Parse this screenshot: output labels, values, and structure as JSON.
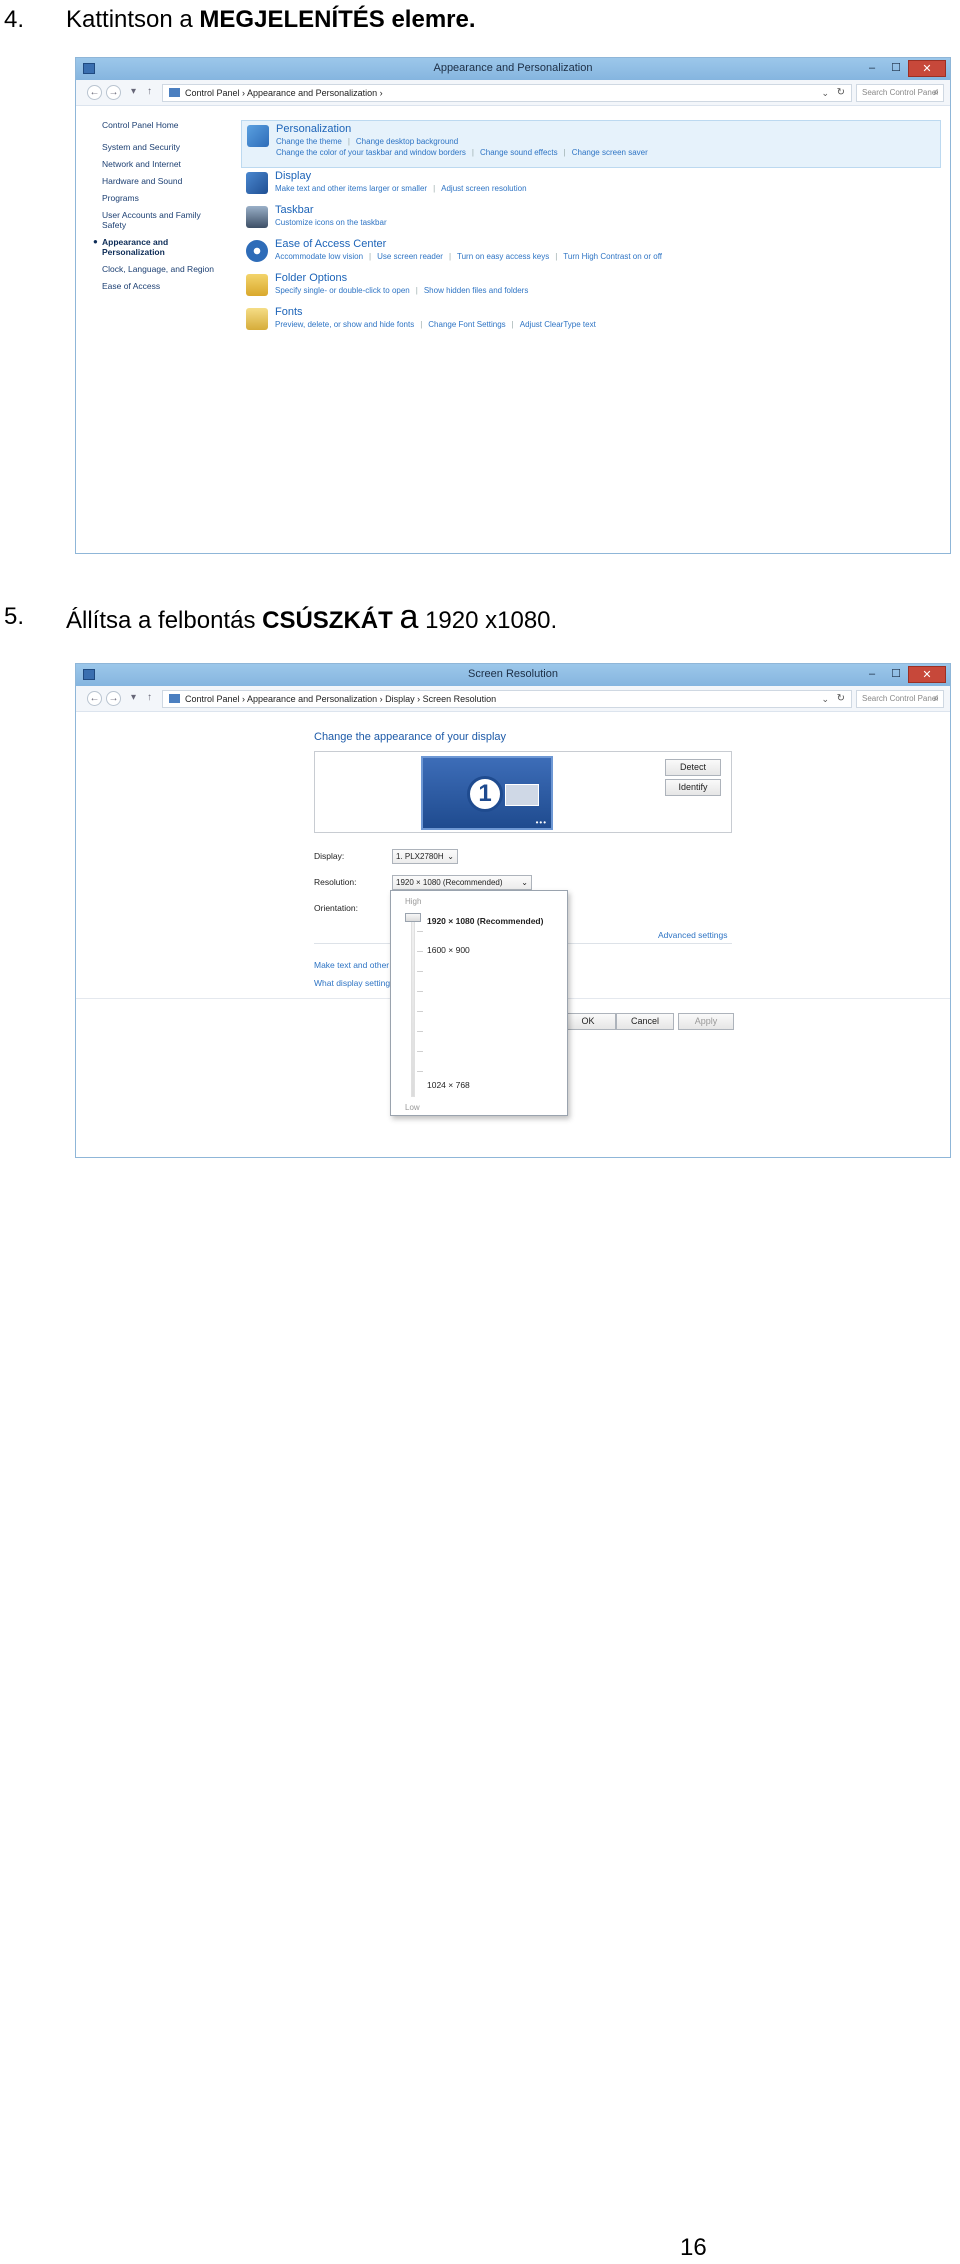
{
  "step4": {
    "number": "4.",
    "text_before": "Kattintson a ",
    "text_bold": "MEGJELENÍTÉS elemre."
  },
  "step5": {
    "number": "5.",
    "text_before": "Állítsa a felbontás ",
    "text_bold": "CSÚSZKÁT",
    "text_a": "a",
    "text_value": "1920 x1080."
  },
  "window1": {
    "title": "Appearance and Personalization",
    "address": "Control Panel  ›  Appearance and Personalization  ›",
    "search_placeholder": "Search Control Panel",
    "sidebar": [
      "Control Panel Home",
      "System and Security",
      "Network and Internet",
      "Hardware and Sound",
      "Programs",
      "User Accounts and Family Safety",
      "Appearance and Personalization",
      "Clock, Language, and Region",
      "Ease of Access"
    ],
    "categories": [
      {
        "title": "Personalization",
        "links": [
          "Change the theme",
          "Change desktop background",
          "Change the color of your taskbar and window borders",
          "Change sound effects",
          "Change screen saver"
        ]
      },
      {
        "title": "Display",
        "links": [
          "Make text and other items larger or smaller",
          "Adjust screen resolution"
        ]
      },
      {
        "title": "Taskbar",
        "links": [
          "Customize icons on the taskbar"
        ]
      },
      {
        "title": "Ease of Access Center",
        "links": [
          "Accommodate low vision",
          "Use screen reader",
          "Turn on easy access keys",
          "Turn High Contrast on or off"
        ]
      },
      {
        "title": "Folder Options",
        "links": [
          "Specify single- or double-click to open",
          "Show hidden files and folders"
        ]
      },
      {
        "title": "Fonts",
        "links": [
          "Preview, delete, or show and hide fonts",
          "Change Font Settings",
          "Adjust ClearType text"
        ]
      }
    ],
    "colors": {
      "titlebar": "#8fbde6",
      "link": "#2e74c4",
      "selected_row": "#e6f2fb"
    }
  },
  "window2": {
    "title": "Screen Resolution",
    "address": "Control Panel  ›  Appearance and Personalization  ›  Display  ›  Screen Resolution",
    "search_placeholder": "Search Control Panel",
    "heading": "Change the appearance of your display",
    "monitor_number": "1",
    "detect_label": "Detect",
    "identify_label": "Identify",
    "display_label": "Display:",
    "display_value": "1. PLX2780H",
    "resolution_label": "Resolution:",
    "resolution_value": "1920 × 1080 (Recommended)",
    "orientation_label": "Orientation:",
    "advanced_link": "Advanced settings",
    "link1": "Make text and other",
    "link2": "What display setting",
    "ok_label": "OK",
    "cancel_label": "Cancel",
    "apply_label": "Apply",
    "popup": {
      "high_label": "High",
      "low_label": "Low",
      "options": [
        "1920 × 1080 (Recommended)",
        "1600 × 900",
        "1024 × 768"
      ],
      "slider_level": 1.0
    }
  },
  "page_number": "16"
}
